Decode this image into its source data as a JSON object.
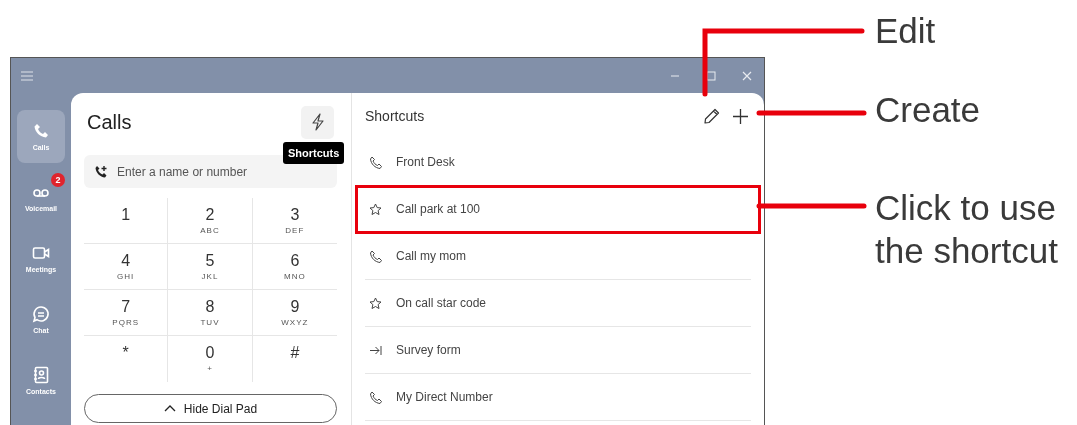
{
  "nav": [
    {
      "kind": "phone",
      "label": "Calls",
      "selected": true
    },
    {
      "kind": "voicemail",
      "label": "Voicemail",
      "selected": false,
      "badge": "2"
    },
    {
      "kind": "video",
      "label": "Meetings",
      "selected": false
    },
    {
      "kind": "chat",
      "label": "Chat",
      "selected": false
    },
    {
      "kind": "contacts",
      "label": "Contacts",
      "selected": false
    }
  ],
  "calls": {
    "title": "Calls",
    "tooltip": "Shortcuts",
    "search": {
      "placeholder": "Enter a name or number"
    },
    "keys": [
      {
        "digit": "1"
      },
      {
        "digit": "2",
        "letters": "ABC"
      },
      {
        "digit": "3",
        "letters": "DEF"
      },
      {
        "digit": "4",
        "letters": "GHI"
      },
      {
        "digit": "5",
        "letters": "JKL"
      },
      {
        "digit": "6",
        "letters": "MNO"
      },
      {
        "digit": "7",
        "letters": "PQRS"
      },
      {
        "digit": "8",
        "letters": "TUV"
      },
      {
        "digit": "9",
        "letters": "WXYZ"
      },
      {
        "digit": "*"
      },
      {
        "digit": "0",
        "letters": "+"
      },
      {
        "digit": "#"
      }
    ],
    "hide_button": "Hide Dial Pad"
  },
  "shortcuts": {
    "title": "Shortcuts",
    "items": [
      {
        "kind": "call",
        "label": "Front Desk",
        "highlighted": false
      },
      {
        "kind": "star",
        "label": "Call park at 100",
        "highlighted": true
      },
      {
        "kind": "call",
        "label": "Call my mom",
        "highlighted": false
      },
      {
        "kind": "star",
        "label": "On call star code",
        "highlighted": false
      },
      {
        "kind": "link",
        "label": "Survey form",
        "highlighted": false
      },
      {
        "kind": "call",
        "label": "My Direct Number",
        "highlighted": false
      }
    ]
  },
  "annotations": [
    {
      "label": "Edit"
    },
    {
      "label": "Create"
    },
    {
      "label": "Click to use the shortcut"
    }
  ]
}
